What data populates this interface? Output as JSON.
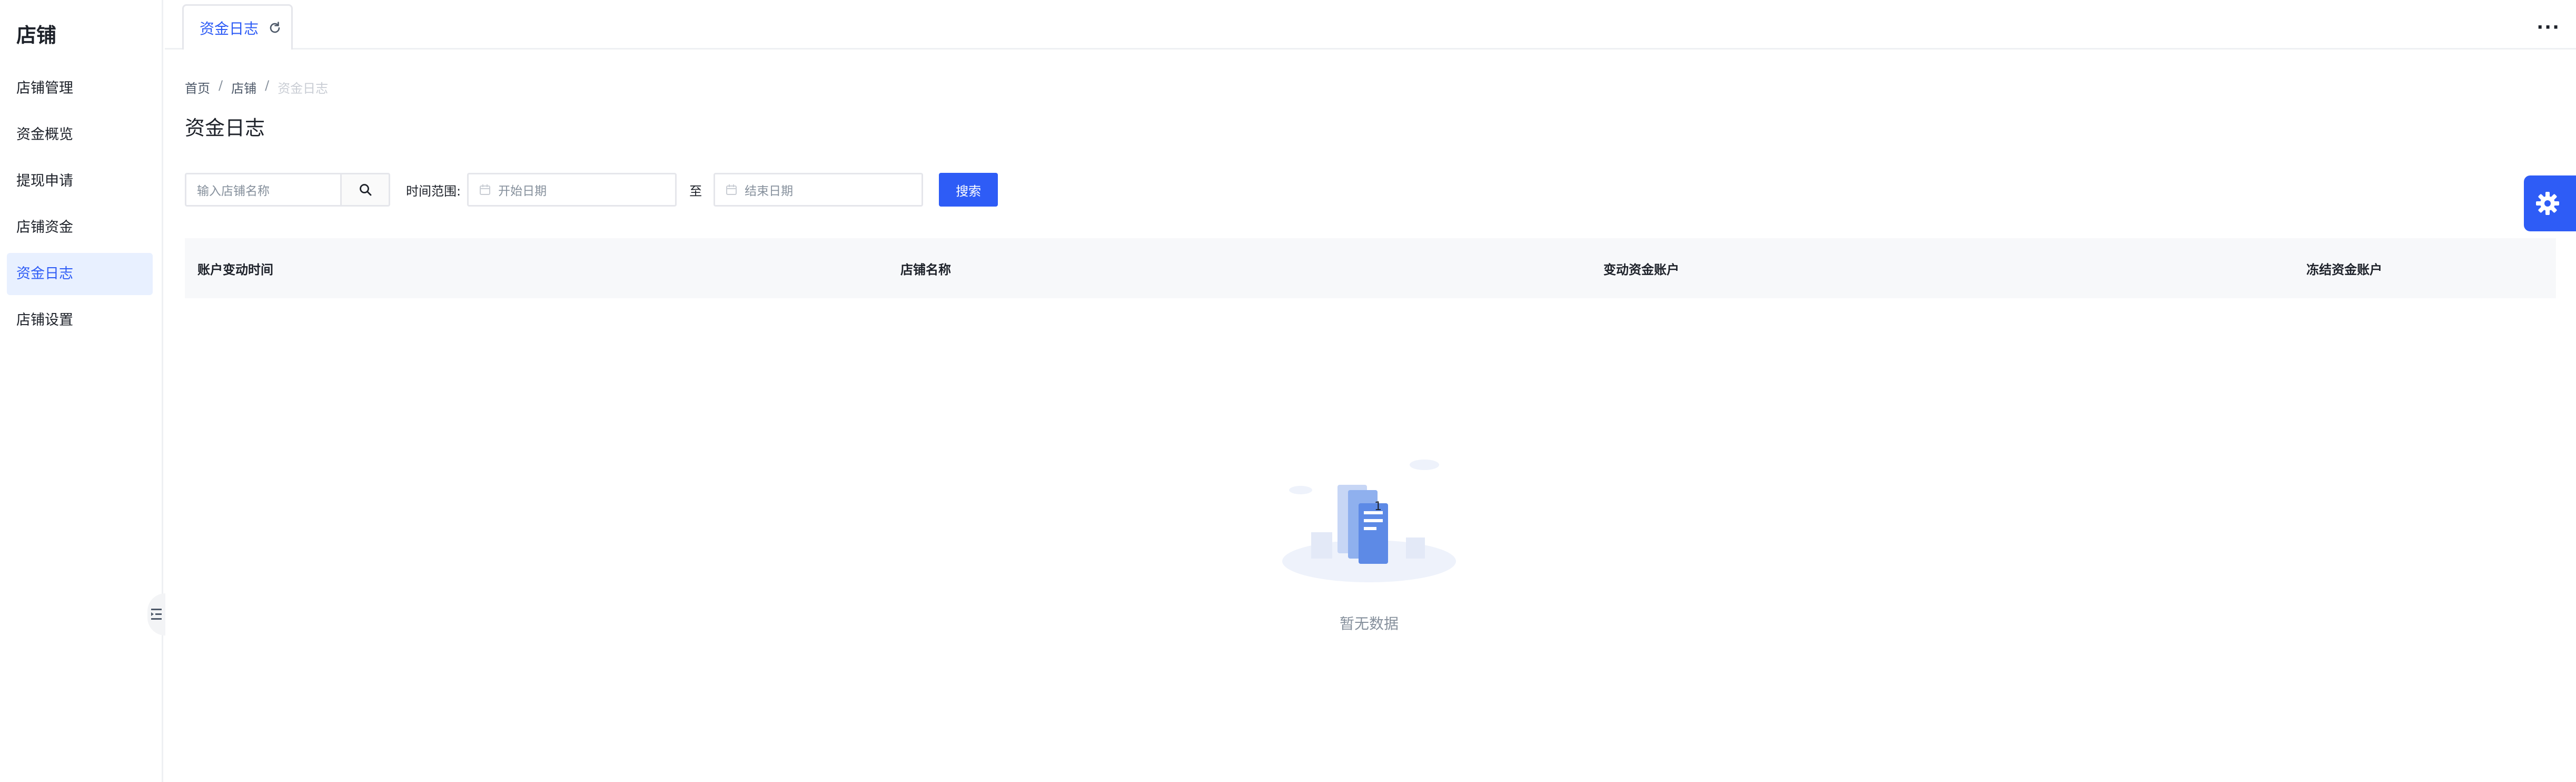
{
  "sidebar": {
    "title": "店铺",
    "items": [
      {
        "label": "店铺管理"
      },
      {
        "label": "资金概览"
      },
      {
        "label": "提现申请"
      },
      {
        "label": "店铺资金"
      },
      {
        "label": "资金日志"
      },
      {
        "label": "店铺设置"
      }
    ],
    "active_index": 4
  },
  "tabbar": {
    "tab_label": "资金日志",
    "more": "···"
  },
  "breadcrumb": [
    "首页",
    "店铺",
    "资金日志"
  ],
  "page_title": "资金日志",
  "filters": {
    "search_placeholder": "输入店铺名称",
    "range_label": "时间范围:",
    "start_placeholder": "开始日期",
    "to_label": "至",
    "end_placeholder": "结束日期",
    "search_button": "搜索"
  },
  "table": {
    "columns": [
      "账户变动时间",
      "店铺名称",
      "变动资金账户",
      "冻结资金账户"
    ]
  },
  "empty_text": "暂无数据",
  "colors": {
    "accent": "#2e5cf6",
    "active_bg": "#e8f0ff"
  }
}
